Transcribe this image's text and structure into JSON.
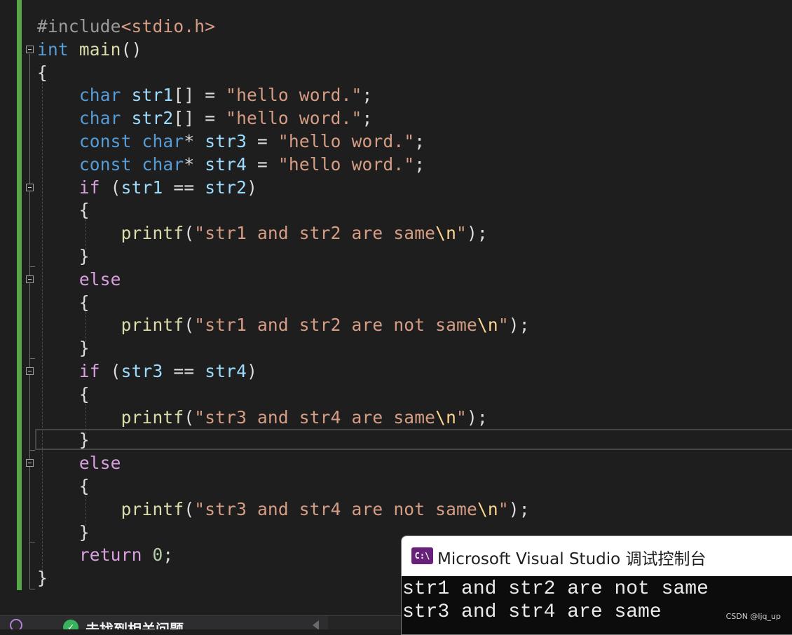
{
  "theme": {
    "keyword": "#569cd6",
    "control": "#d8a0df",
    "string": "#d69d85",
    "escape": "#ffd68f",
    "function": "#dcdcaa",
    "variable": "#9cdcfe",
    "number": "#b5cea8",
    "preprocessor": "#9b9b9b",
    "text": "#dcdcdc",
    "change_bar": "#57a64a"
  },
  "editor": {
    "lines": [
      [
        {
          "t": "#include",
          "c": "preprocessor"
        },
        {
          "t": "<stdio.h>",
          "c": "string"
        }
      ],
      [
        {
          "t": "int",
          "c": "keyword"
        },
        {
          "t": " ",
          "c": "text"
        },
        {
          "t": "main",
          "c": "function"
        },
        {
          "t": "()",
          "c": "text"
        }
      ],
      [
        {
          "t": "{",
          "c": "text"
        }
      ],
      [
        {
          "t": "    ",
          "c": "text"
        },
        {
          "t": "char",
          "c": "keyword"
        },
        {
          "t": " ",
          "c": "text"
        },
        {
          "t": "str1",
          "c": "variable"
        },
        {
          "t": "[] = ",
          "c": "text"
        },
        {
          "t": "\"hello word.\"",
          "c": "string"
        },
        {
          "t": ";",
          "c": "text"
        }
      ],
      [
        {
          "t": "    ",
          "c": "text"
        },
        {
          "t": "char",
          "c": "keyword"
        },
        {
          "t": " ",
          "c": "text"
        },
        {
          "t": "str2",
          "c": "variable"
        },
        {
          "t": "[] = ",
          "c": "text"
        },
        {
          "t": "\"hello word.\"",
          "c": "string"
        },
        {
          "t": ";",
          "c": "text"
        }
      ],
      [
        {
          "t": "    ",
          "c": "text"
        },
        {
          "t": "const",
          "c": "keyword"
        },
        {
          "t": " ",
          "c": "text"
        },
        {
          "t": "char",
          "c": "keyword"
        },
        {
          "t": "* ",
          "c": "text"
        },
        {
          "t": "str3",
          "c": "variable"
        },
        {
          "t": " = ",
          "c": "text"
        },
        {
          "t": "\"hello word.\"",
          "c": "string"
        },
        {
          "t": ";",
          "c": "text"
        }
      ],
      [
        {
          "t": "    ",
          "c": "text"
        },
        {
          "t": "const",
          "c": "keyword"
        },
        {
          "t": " ",
          "c": "text"
        },
        {
          "t": "char",
          "c": "keyword"
        },
        {
          "t": "* ",
          "c": "text"
        },
        {
          "t": "str4",
          "c": "variable"
        },
        {
          "t": " = ",
          "c": "text"
        },
        {
          "t": "\"hello word.\"",
          "c": "string"
        },
        {
          "t": ";",
          "c": "text"
        }
      ],
      [
        {
          "t": "    ",
          "c": "text"
        },
        {
          "t": "if",
          "c": "control"
        },
        {
          "t": " (",
          "c": "text"
        },
        {
          "t": "str1",
          "c": "variable"
        },
        {
          "t": " == ",
          "c": "text"
        },
        {
          "t": "str2",
          "c": "variable"
        },
        {
          "t": ")",
          "c": "text"
        }
      ],
      [
        {
          "t": "    {",
          "c": "text"
        }
      ],
      [
        {
          "t": "        ",
          "c": "text"
        },
        {
          "t": "printf",
          "c": "function"
        },
        {
          "t": "(",
          "c": "text"
        },
        {
          "t": "\"str1 and str2 are same",
          "c": "string"
        },
        {
          "t": "\\n",
          "c": "escape"
        },
        {
          "t": "\"",
          "c": "string"
        },
        {
          "t": ");",
          "c": "text"
        }
      ],
      [
        {
          "t": "    }",
          "c": "text"
        }
      ],
      [
        {
          "t": "    ",
          "c": "text"
        },
        {
          "t": "else",
          "c": "control"
        }
      ],
      [
        {
          "t": "    {",
          "c": "text"
        }
      ],
      [
        {
          "t": "        ",
          "c": "text"
        },
        {
          "t": "printf",
          "c": "function"
        },
        {
          "t": "(",
          "c": "text"
        },
        {
          "t": "\"str1 and str2 are not same",
          "c": "string"
        },
        {
          "t": "\\n",
          "c": "escape"
        },
        {
          "t": "\"",
          "c": "string"
        },
        {
          "t": ");",
          "c": "text"
        }
      ],
      [
        {
          "t": "    }",
          "c": "text"
        }
      ],
      [
        {
          "t": "    ",
          "c": "text"
        },
        {
          "t": "if",
          "c": "control"
        },
        {
          "t": " (",
          "c": "text"
        },
        {
          "t": "str3",
          "c": "variable"
        },
        {
          "t": " == ",
          "c": "text"
        },
        {
          "t": "str4",
          "c": "variable"
        },
        {
          "t": ")",
          "c": "text"
        }
      ],
      [
        {
          "t": "    {",
          "c": "text"
        }
      ],
      [
        {
          "t": "        ",
          "c": "text"
        },
        {
          "t": "printf",
          "c": "function"
        },
        {
          "t": "(",
          "c": "text"
        },
        {
          "t": "\"str3 and str4 are same",
          "c": "string"
        },
        {
          "t": "\\n",
          "c": "escape"
        },
        {
          "t": "\"",
          "c": "string"
        },
        {
          "t": ");",
          "c": "text"
        }
      ],
      [
        {
          "t": "    }",
          "c": "text"
        }
      ],
      [
        {
          "t": "    ",
          "c": "text"
        },
        {
          "t": "else",
          "c": "control"
        }
      ],
      [
        {
          "t": "    {",
          "c": "text"
        }
      ],
      [
        {
          "t": "        ",
          "c": "text"
        },
        {
          "t": "printf",
          "c": "function"
        },
        {
          "t": "(",
          "c": "text"
        },
        {
          "t": "\"str3 and str4 are not same",
          "c": "string"
        },
        {
          "t": "\\n",
          "c": "escape"
        },
        {
          "t": "\"",
          "c": "string"
        },
        {
          "t": ");",
          "c": "text"
        }
      ],
      [
        {
          "t": "    }",
          "c": "text"
        }
      ],
      [
        {
          "t": "    ",
          "c": "text"
        },
        {
          "t": "return",
          "c": "control"
        },
        {
          "t": " ",
          "c": "text"
        },
        {
          "t": "0",
          "c": "number"
        },
        {
          "t": ";",
          "c": "text"
        }
      ],
      [
        {
          "t": "}",
          "c": "text"
        }
      ]
    ]
  },
  "console": {
    "title": "Microsoft Visual Studio 调试控制台",
    "icon_label": "C:\\",
    "output": [
      "str1 and str2 are not same",
      "str3 and str4 are same"
    ]
  },
  "status_bar": {
    "message": "未找到相关问题"
  },
  "watermark": "CSDN @ljq_up"
}
